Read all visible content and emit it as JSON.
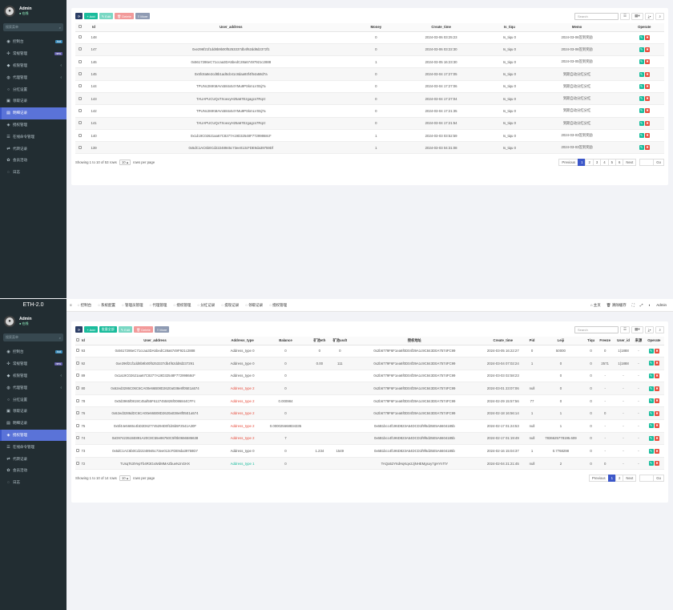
{
  "pane1": {
    "user": {
      "name": "Admin",
      "status": "● 在线"
    },
    "search_placeholder": "搜索菜单",
    "menu": [
      {
        "label": "控制台",
        "badge": "hot",
        "badge_color": "#3c8dbc",
        "active": false
      },
      {
        "label": "常规管理",
        "badge": "new",
        "badge_color": "#605ca8",
        "active": false
      },
      {
        "label": "权限管理",
        "chev": "‹",
        "active": false
      },
      {
        "label": "代理管理",
        "chev": "‹",
        "active": false
      },
      {
        "label": "分红设置",
        "active": false
      },
      {
        "label": "领取记录",
        "active": false
      },
      {
        "label": "明细记录",
        "active": true
      },
      {
        "label": "授权管理",
        "active": false
      },
      {
        "label": "在线命令管理",
        "active": false
      },
      {
        "label": "代转记录",
        "active": false
      },
      {
        "label": "会员活动",
        "active": false
      },
      {
        "label": "日志",
        "active": false
      }
    ],
    "toolbar": {
      "add": "+ Add",
      "edit": "✎ Edit",
      "delete": "🗑 Delete",
      "more": "≡ More",
      "search_placeholder": "Search"
    },
    "columns": [
      "Id",
      "User_address",
      "Money",
      "Create_time",
      "Is_tiqu",
      "Memo",
      "Operate"
    ],
    "rows": [
      [
        "148",
        "",
        "0",
        "2024-03-06 03:25:23",
        "Is_tiqu 0",
        "2024-03-06签到奖励"
      ],
      [
        "147",
        "0xe296f21f1dd8b9b00f5253337db4f62dd8d2372f1",
        "0",
        "2024-03-06 03:22:30",
        "Is_tiqu 0",
        "2024-03-06签到奖励"
      ],
      [
        "146",
        "0x5617286eC71ccaa3DA5bedC28a67497921c2888",
        "1",
        "2024-03-05 16:23:30",
        "Is_tiqu 0",
        "2024-03-05签到奖励"
      ],
      [
        "145",
        "0x5fc8a8e2cd8b1ad5cb41c8daa93f4f54a58d7a",
        "0",
        "2024-03-04 17:27:05",
        "Is_tiqu 0",
        "到期自动分红分红"
      ],
      [
        "144",
        "TPUNc2MKMAVx584x54YMu9PSkmLVS5j7a",
        "0",
        "2024-03-04 17:27:06",
        "Is_tiqu 0",
        "到期自动分红分红"
      ],
      [
        "143",
        "TAUAPUCUQxTXoexyH25a67Ezgagcs7Rqrz",
        "0",
        "2024-03-04 17:27:04",
        "Is_tiqu 0",
        "到期自动分红分红"
      ],
      [
        "142",
        "TPUNc2MKMAVx584x54YMu9PSkmLVS5j7a",
        "0",
        "2024-03-04 17:21:35",
        "Is_tiqu 0",
        "到期自动分红分红"
      ],
      [
        "141",
        "TAUAPUCUQxTXoexyH25a67Ezgagcs7Rqrz",
        "0",
        "2024-03-04 17:21:54",
        "Is_tiqu 0",
        "到期自动分红分红"
      ],
      [
        "140",
        "0x1d19C02621aa67C8277A19D32548F77299868cF",
        "1",
        "2024-03-03 03:52:59",
        "Is_tiqu 0",
        "2024-03-03签到奖励"
      ],
      [
        "139",
        "0x5dC1AC6b0Cd22248945c73ee013cFDE9da39759Df",
        "1",
        "2024-03-03 04:31:08",
        "Is_tiqu 0",
        "2024-03-03签到奖励"
      ]
    ],
    "footer": {
      "showing": "Showing 1 to 10 of 53 rows",
      "psize": "10 ▴",
      "per": "rows per page"
    },
    "pager": [
      "Previous",
      "1",
      "2",
      "3",
      "4",
      "5",
      "6",
      "Next",
      "",
      "Go"
    ]
  },
  "pane2": {
    "brand": "ETH-2.0",
    "user": {
      "name": "Admin",
      "status": "● 在线"
    },
    "search_placeholder": "搜索菜单",
    "topnav": [
      "控制台",
      "系统配置",
      "管理员管理",
      "代理管理",
      "授权管理",
      "分红记录",
      "提现记录",
      "领取记录",
      "授权管理"
    ],
    "topnav_right": [
      "主页",
      "清除缓存",
      "",
      "",
      "",
      "Admin"
    ],
    "menu": [
      {
        "label": "控制台",
        "badge": "hot",
        "badge_color": "#3c8dbc",
        "active": false
      },
      {
        "label": "常规管理",
        "badge": "new",
        "badge_color": "#605ca8",
        "active": false
      },
      {
        "label": "权限管理",
        "chev": "‹",
        "active": false
      },
      {
        "label": "代理管理",
        "chev": "‹",
        "active": false
      },
      {
        "label": "分红设置",
        "active": false
      },
      {
        "label": "领取记录",
        "active": false
      },
      {
        "label": "明细记录",
        "active": false
      },
      {
        "label": "授权管理",
        "active": true
      },
      {
        "label": "在线命令管理",
        "active": false
      },
      {
        "label": "代转记录",
        "active": false
      },
      {
        "label": "会员活动",
        "active": false
      },
      {
        "label": "日志",
        "active": false
      }
    ],
    "toolbar": {
      "add": "+ Add",
      "all": "批量全部",
      "edit": "✎ Edit",
      "delete": "🗑 Delete",
      "more": "≡ More",
      "search_placeholder": "Search"
    },
    "columns": [
      "Id",
      "User_address",
      "Address_type",
      "Balance",
      "矿池eth",
      "矿池usdt",
      "授权地址",
      "Create_time",
      "Pid",
      "Leiji",
      "Tiqu",
      "Freeze",
      "User_id",
      "来源",
      "Operate"
    ],
    "rows": [
      [
        "93",
        "0x5617286eC71ccaa3DA5bedC28a6749F921c2888",
        "Address_type 0",
        "0",
        "0",
        "0",
        "0x2b6779F6F1ea6f0D04f39A1c9C843D0A7574FC99",
        "2024-03-05 16:22:27",
        "0",
        "50000",
        "0",
        "0",
        "1(1888",
        "-"
      ],
      [
        "92",
        "0xe296f21f1dd8b9b00f5253337db4f62dd8d237291",
        "Address_type 0",
        "0",
        "0.00",
        "111",
        "0x2b6779F6F1ea6f0D04f39A1c9C843D0A7574FC99",
        "2024-03-04 07:02:24",
        "1",
        "0",
        "0",
        "2571",
        "1(1888",
        "-"
      ],
      [
        "89",
        "0x1a19C02621aa67C8277A19D32548F77299868cF",
        "Address_type 0",
        "0",
        "",
        "",
        "0x2b6779F6F1ea6f0D04f39A1c9C843D0A7574FC99",
        "2024-03-03 02:58:23",
        "",
        "0",
        "0",
        "-",
        "-",
        "-"
      ],
      [
        "80",
        "0x62ed3286C06C6CA00e66B08D2620a038e8f05E1a574",
        "Address_type 2",
        "0",
        "",
        "",
        "0x2b6779F6F1ea6f0D04f39A1c9C843D0A7574FC99",
        "2024-03-01 23:07:06",
        "null",
        "0",
        "0",
        "-",
        "-",
        "-"
      ],
      [
        "78",
        "0x0d3965f0819C45af55F6127455826f0086844CFFc",
        "Address_type 2",
        "0.000984",
        "",
        "",
        "0x2b6779F6F1ea6f0D04f39A1c9C843D0A7574FC99",
        "2024-02-29 15:57:56",
        "77",
        "0",
        "0",
        "-",
        "-",
        "-"
      ],
      [
        "76",
        "0x62ed3286dDC6CA00e66B08D2620a038e8f05E1a574",
        "Address_type 2",
        "0",
        "",
        "",
        "0x2b6779F6F1ea6f0D04f39A1c9C843D0A7574FC99",
        "2024-02-18 16:56:14",
        "1",
        "1",
        "0",
        "0",
        "-",
        "-"
      ],
      [
        "75",
        "0x5f44e5665c4bD2D627745294D0f1b5b5F2541A30F",
        "Address_type 2",
        "0.000025668834335",
        "",
        "",
        "0x6B1bcc4f196D823A54DCD1f9f6d25E5A6604185b",
        "2024-02-17 01:24:53",
        "null",
        "1",
        "0",
        "-",
        "-",
        "-"
      ],
      [
        "74",
        "0xD97423515E891A20C8C55e86750C5f0b0656586638",
        "Address_type 2",
        "7",
        "",
        "",
        "0x6B1bcc4f196D823A54DCD1f9f6d25E5A6604185b",
        "2024-02-17 01:19:49",
        "null",
        "7836625778195.609",
        "0",
        "-",
        "-",
        "-"
      ],
      [
        "73",
        "0x5dC1AC6b0Cd22248945c73ee013cFDE9da39759D7",
        "Address_type 0",
        "0",
        "1.234",
        "1549",
        "0x6B1bcc4f196D823A54DCD1f9f6d25E5A6604185b",
        "2024-02-16 15:04:37",
        "1",
        "0.7768298",
        "0",
        "-",
        "-",
        "-"
      ],
      [
        "72",
        "TUsqTs3tYepTb4R3GxWdMMAZbueNJnGHX",
        "Address_type 1",
        "0",
        "",
        "",
        "TAQa52Y6dHqKqe2JjNHEMgsoy7gHYnTtY",
        "2024-02-04 21:21:45",
        "null",
        "2",
        "0",
        "0",
        "-",
        "-"
      ]
    ],
    "type_colors": [
      "",
      "",
      "",
      "red",
      "red",
      "red",
      "red",
      "red",
      "",
      "green"
    ],
    "footer": {
      "showing": "Showing 1 to 10 of 14 rows",
      "psize": "10 ▴",
      "per": "rows per page"
    },
    "pager": [
      "Previous",
      "1",
      "2",
      "Next",
      "",
      "Go"
    ]
  }
}
